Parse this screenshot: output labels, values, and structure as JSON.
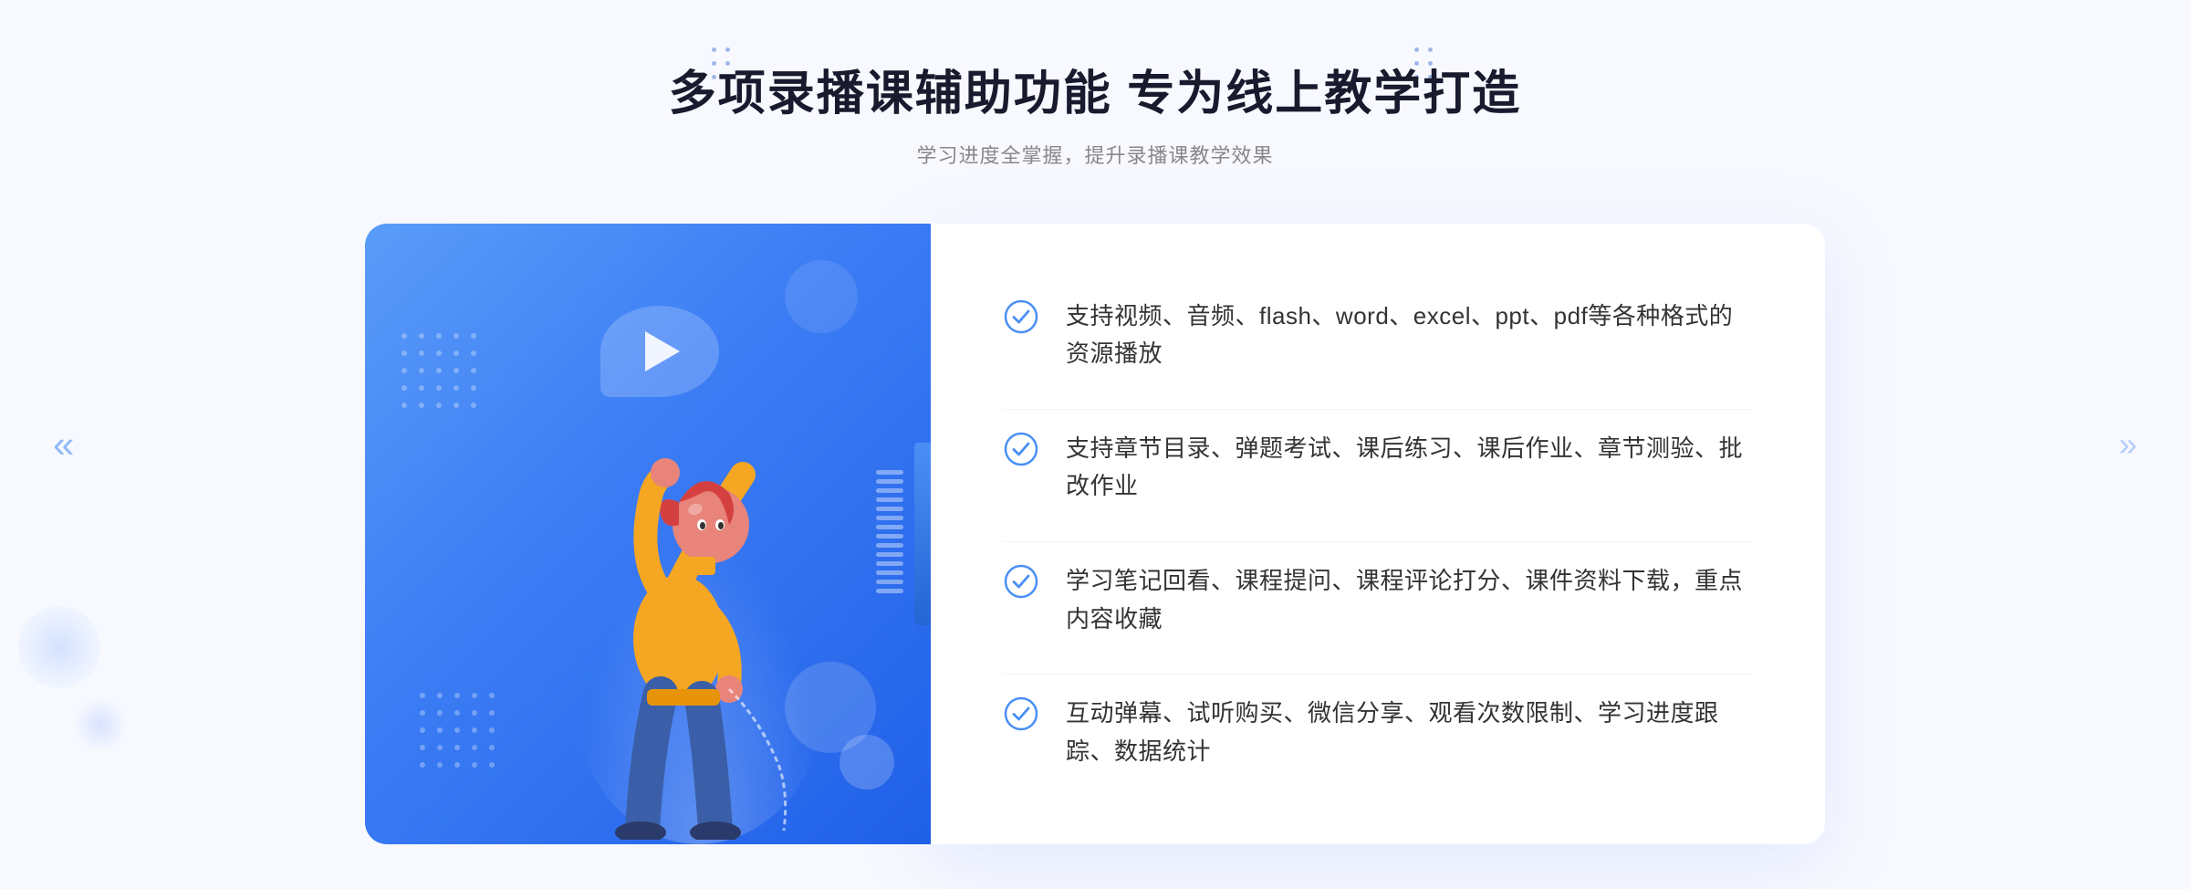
{
  "page": {
    "background": "#f8f9ff"
  },
  "header": {
    "main_title": "多项录播课辅助功能 专为线上教学打造",
    "subtitle": "学习进度全掌握，提升录播课教学效果"
  },
  "features": [
    {
      "id": "feature-1",
      "text": "支持视频、音频、flash、word、excel、ppt、pdf等各种格式的资源播放"
    },
    {
      "id": "feature-2",
      "text": "支持章节目录、弹题考试、课后练习、课后作业、章节测验、批改作业"
    },
    {
      "id": "feature-3",
      "text": "学习笔记回看、课程提问、课程评论打分、课件资料下载，重点内容收藏"
    },
    {
      "id": "feature-4",
      "text": "互动弹幕、试听购买、微信分享、观看次数限制、学习进度跟踪、数据统计"
    }
  ],
  "icons": {
    "check": "✓",
    "chevron_left": "«",
    "chevron_right": "»",
    "play": "▶"
  },
  "colors": {
    "primary_blue": "#3d7ef5",
    "dark_blue": "#2060e8",
    "light_blue": "#5a9cf8",
    "text_dark": "#1a1a2e",
    "text_medium": "#333333",
    "text_light": "#888888",
    "check_blue": "#4a8ff5"
  }
}
